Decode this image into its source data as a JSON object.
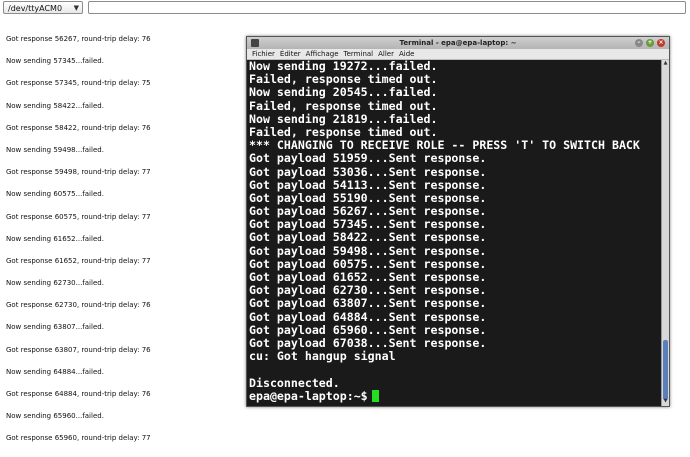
{
  "toolbar": {
    "port_value": "/dev/ttyACM0",
    "command_value": ""
  },
  "log": [
    "Got response 56267, round-trip delay: 76",
    "Now sending 57345...failed.",
    "Got response 57345, round-trip delay: 75",
    "Now sending 58422...failed.",
    "Got response 58422, round-trip delay: 76",
    "Now sending 59498...failed.",
    "Got response 59498, round-trip delay: 77",
    "Now sending 60575...failed.",
    "Got response 60575, round-trip delay: 77",
    "Now sending 61652...failed.",
    "Got response 61652, round-trip delay: 77",
    "Now sending 62730...failed.",
    "Got response 62730, round-trip delay: 76",
    "Now sending 63807...failed.",
    "Got response 63807, round-trip delay: 76",
    "Now sending 64884...failed.",
    "Got response 64884, round-trip delay: 76",
    "Now sending 65960...failed.",
    "Got response 65960, round-trip delay: 77"
  ],
  "terminal": {
    "title": "Terminal - epa@epa-laptop: ~",
    "menu": [
      "Fichier",
      "Éditer",
      "Affichage",
      "Terminal",
      "Aller",
      "Aide"
    ],
    "lines": [
      "Now sending 19272...failed.",
      "Failed, response timed out.",
      "Now sending 20545...failed.",
      "Failed, response timed out.",
      "Now sending 21819...failed.",
      "Failed, response timed out.",
      "*** CHANGING TO RECEIVE ROLE -- PRESS 'T' TO SWITCH BACK",
      "Got payload 51959...Sent response.",
      "Got payload 53036...Sent response.",
      "Got payload 54113...Sent response.",
      "Got payload 55190...Sent response.",
      "Got payload 56267...Sent response.",
      "Got payload 57345...Sent response.",
      "Got payload 58422...Sent response.",
      "Got payload 59498...Sent response.",
      "Got payload 60575...Sent response.",
      "Got payload 61652...Sent response.",
      "Got payload 62730...Sent response.",
      "Got payload 63807...Sent response.",
      "Got payload 64884...Sent response.",
      "Got payload 65960...Sent response.",
      "Got payload 67038...Sent response.",
      "cu: Got hangup signal",
      "",
      "Disconnected."
    ],
    "prompt": "epa@epa-laptop:~$",
    "cursor_color": "#22dd22"
  }
}
